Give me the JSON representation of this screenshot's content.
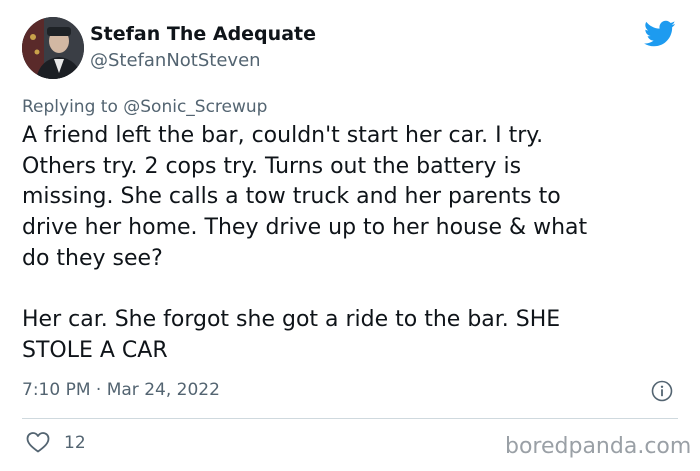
{
  "author": {
    "name": "Stefan The Adequate",
    "handle": "@StefanNotSteven"
  },
  "reply": {
    "prefix": "Replying to ",
    "to_handle": "@Sonic_Screwup"
  },
  "tweet": {
    "paragraphs": [
      "A friend left the bar, couldn't start her car. I try.\nOthers try. 2 cops try. Turns out the battery is\nmissing. She calls a tow truck and her parents to\ndrive her home. They drive up to her house & what\ndo they see?",
      "Her car. She forgot she got a ride to the bar. SHE\nSTOLE A CAR"
    ],
    "timestamp": "7:10 PM · Mar 24, 2022"
  },
  "engagement": {
    "likes": "12"
  },
  "watermark": "boredpanda.com",
  "colors": {
    "twitter_blue": "#1d9bf0",
    "secondary_text": "#536471",
    "primary_text": "#0f1419"
  },
  "icons": {
    "brand": "twitter-bird-icon",
    "info": "info-icon",
    "like": "heart-icon"
  }
}
